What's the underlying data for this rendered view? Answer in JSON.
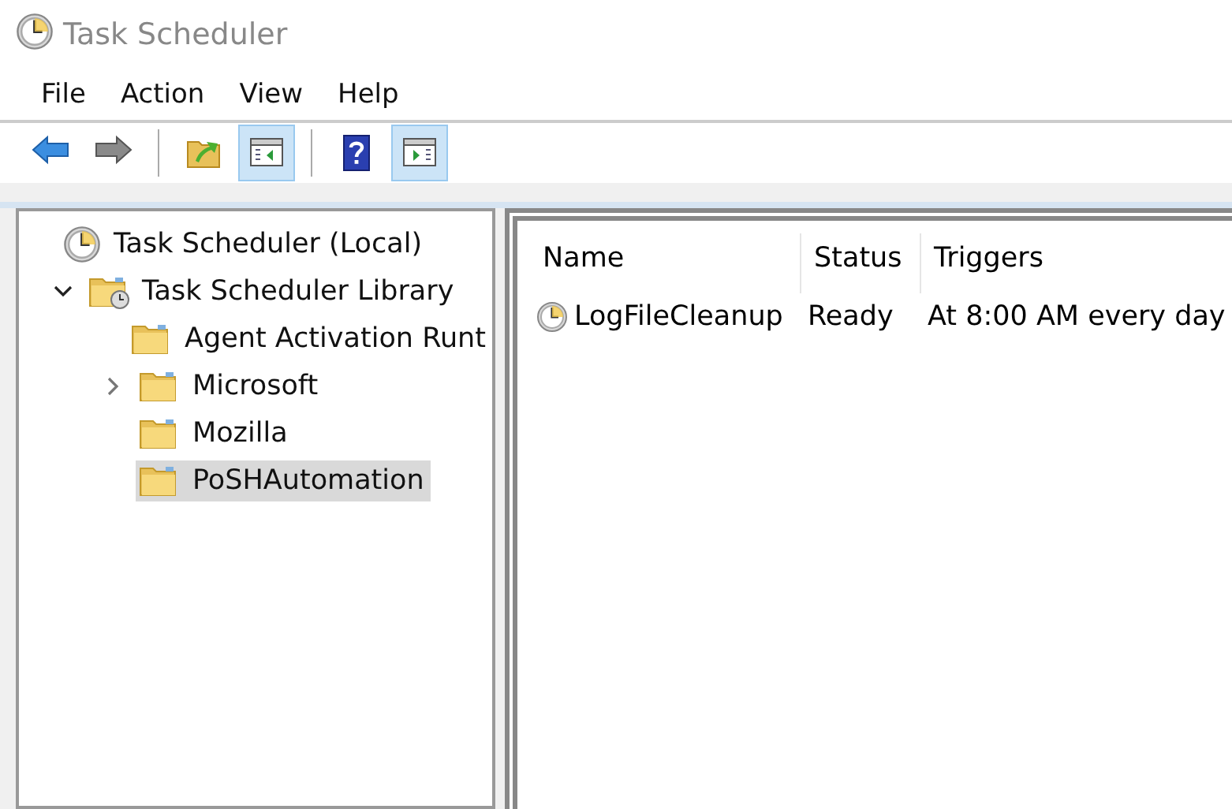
{
  "window": {
    "title": "Task Scheduler"
  },
  "menu": [
    "File",
    "Action",
    "View",
    "Help"
  ],
  "toolbar": [
    {
      "kind": "back",
      "pressed": false
    },
    {
      "kind": "forward",
      "pressed": false
    },
    {
      "kind": "separator"
    },
    {
      "kind": "up",
      "pressed": false
    },
    {
      "kind": "tree",
      "pressed": true
    },
    {
      "kind": "separator"
    },
    {
      "kind": "help",
      "pressed": false
    },
    {
      "kind": "actions",
      "pressed": true
    }
  ],
  "tree": [
    {
      "label": "Task Scheduler (Local)",
      "kind": "clock",
      "selected": false,
      "children": [
        {
          "label": "Task Scheduler Library",
          "kind": "library",
          "selected": false,
          "expanded": true,
          "children": [
            {
              "label": "Agent Activation Runt",
              "kind": "folder",
              "selected": false
            },
            {
              "label": "Microsoft",
              "kind": "folder",
              "selected": false,
              "expanded": false
            },
            {
              "label": "Mozilla",
              "kind": "folder",
              "selected": false
            },
            {
              "label": "PoSHAutomation",
              "kind": "folder",
              "selected": true
            }
          ]
        }
      ]
    }
  ],
  "table": {
    "columns": [
      "Name",
      "Status",
      "Triggers"
    ],
    "rows": [
      {
        "cells": [
          "LogFileCleanup",
          "Ready",
          "At 8:00 AM every day"
        ],
        "selected": false
      }
    ]
  }
}
